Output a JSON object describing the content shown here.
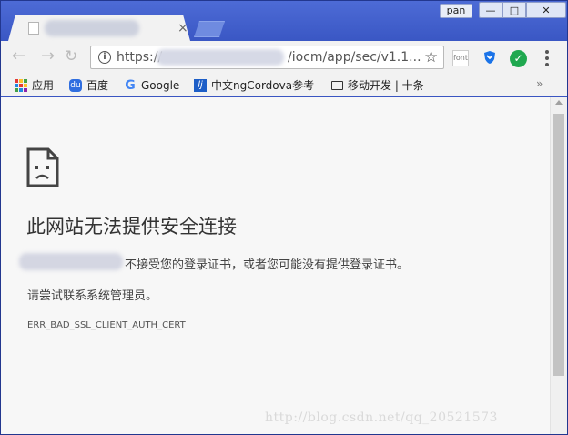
{
  "window": {
    "profile_label": "pan",
    "minimize_glyph": "—",
    "maximize_glyph": "□",
    "close_glyph": "✕"
  },
  "tab": {
    "close_glyph": "×"
  },
  "toolbar": {
    "back_glyph": "←",
    "forward_glyph": "→",
    "reload_glyph": "↻",
    "url_scheme": "https://",
    "url_path": "/iocm/app/sec/v1.1...",
    "info_glyph": "i",
    "star_glyph": "☆",
    "ext_font_label": "font"
  },
  "bookmarks": {
    "items": [
      {
        "label": "应用",
        "icon": "apps-grid-icon"
      },
      {
        "label": "百度",
        "icon": "baidu-icon"
      },
      {
        "label": "Google",
        "icon": "google-icon"
      },
      {
        "label": "中文ngCordova参考",
        "icon": "ngcordova-icon"
      },
      {
        "label": "移动开发 | 十条",
        "icon": "screen-icon"
      }
    ],
    "more_glyph": "»"
  },
  "content": {
    "title": "此网站无法提供安全连接",
    "cert_message": "不接受您的登录证书，或者您可能没有提供登录证书。",
    "admin_message": "请尝试联系系统管理员。",
    "error_code": "ERR_BAD_SSL_CLIENT_AUTH_CERT",
    "watermark": "http://blog.csdn.net/qq_20521573"
  },
  "colors": {
    "frame": "#3a55c2",
    "page_bg": "#f7f7f7",
    "title_text": "#333333"
  }
}
